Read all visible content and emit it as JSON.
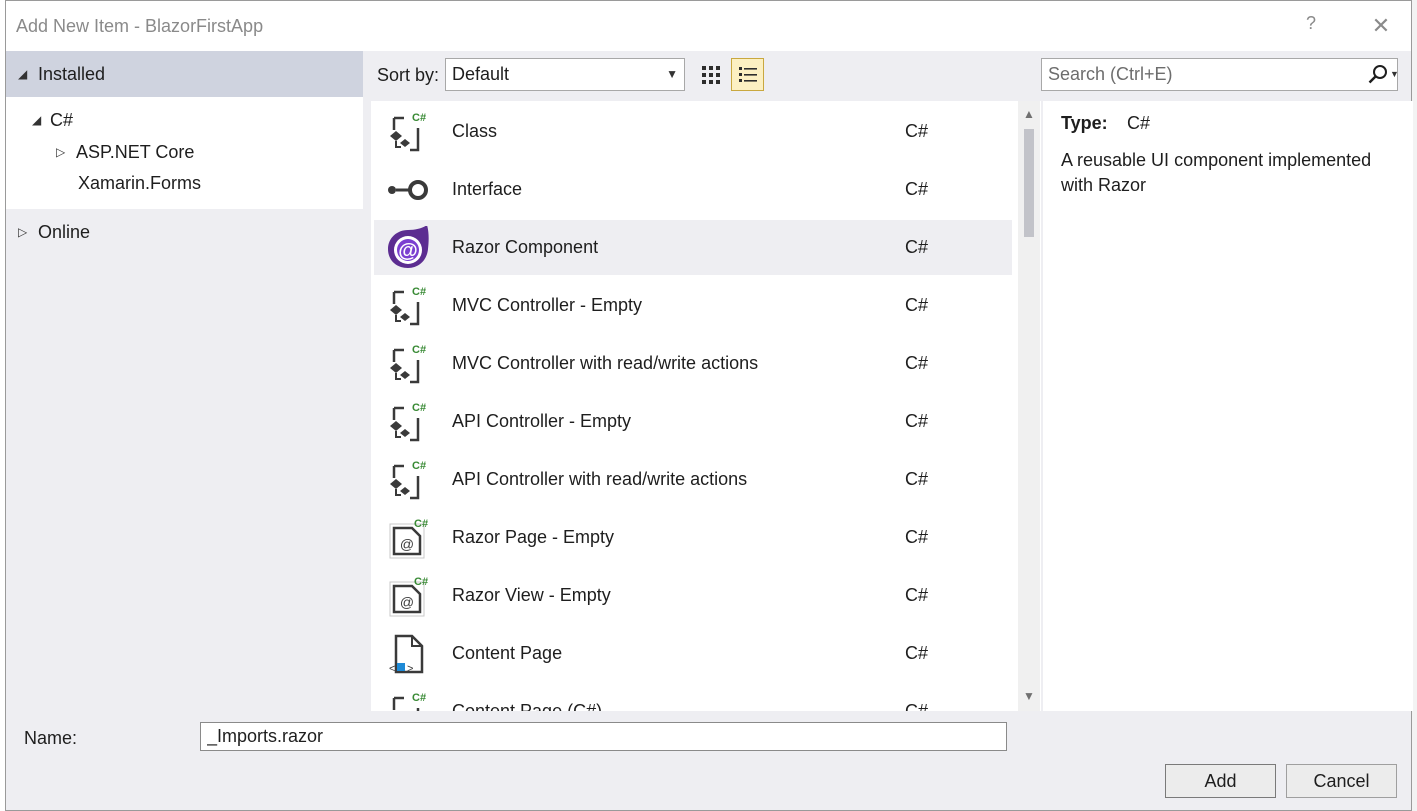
{
  "window": {
    "title": "Add New Item - BlazorFirstApp",
    "help_glyph": "?",
    "close_glyph": "✕"
  },
  "tree": {
    "installed": "Installed",
    "csharp": "C#",
    "aspnet_core": "ASP.NET Core",
    "xamarin_forms": "Xamarin.Forms",
    "online": "Online"
  },
  "toolbar": {
    "sort_label": "Sort by:",
    "sort_value": "Default",
    "search_placeholder": "Search (Ctrl+E)"
  },
  "templates": [
    {
      "name": "Class",
      "lang": "C#",
      "icon": "csharp-class-icon"
    },
    {
      "name": "Interface",
      "lang": "C#",
      "icon": "interface-icon"
    },
    {
      "name": "Razor Component",
      "lang": "C#",
      "icon": "razor-component-icon"
    },
    {
      "name": "MVC Controller - Empty",
      "lang": "C#",
      "icon": "csharp-class-icon"
    },
    {
      "name": "MVC Controller with read/write actions",
      "lang": "C#",
      "icon": "csharp-class-icon"
    },
    {
      "name": "API Controller - Empty",
      "lang": "C#",
      "icon": "csharp-class-icon"
    },
    {
      "name": "API Controller with read/write actions",
      "lang": "C#",
      "icon": "csharp-class-icon"
    },
    {
      "name": "Razor Page - Empty",
      "lang": "C#",
      "icon": "razor-page-icon"
    },
    {
      "name": "Razor View - Empty",
      "lang": "C#",
      "icon": "razor-page-icon"
    },
    {
      "name": "Content Page",
      "lang": "C#",
      "icon": "content-page-icon"
    },
    {
      "name": "Content Page (C#)",
      "lang": "C#",
      "icon": "csharp-class-icon"
    }
  ],
  "selected_index": 2,
  "info": {
    "type_label": "Type:",
    "type_value": "C#",
    "description": "A reusable UI component implemented with Razor"
  },
  "footer": {
    "name_label": "Name:",
    "name_value": "_Imports.razor",
    "add_label": "Add",
    "cancel_label": "Cancel"
  },
  "colors": {
    "selected_row": "#eeeef2",
    "active_view_button": "#fcf0c2",
    "razor_purple": "#5c2d91",
    "csharp_green": "#388a34"
  }
}
